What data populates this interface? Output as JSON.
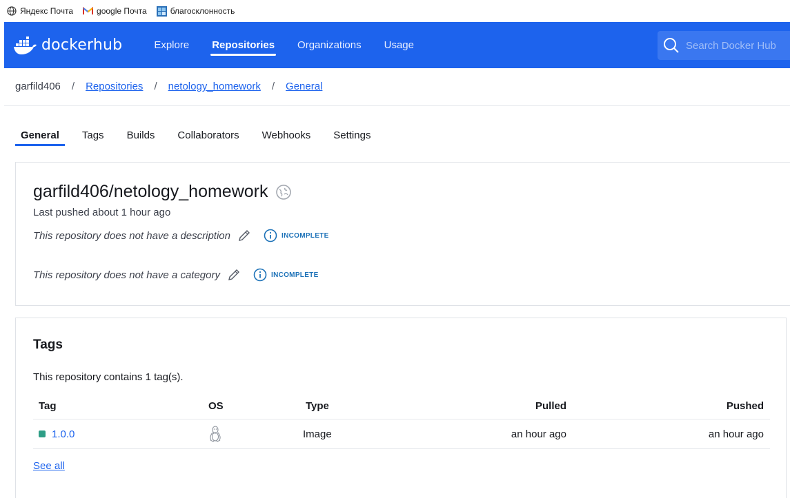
{
  "bookmarks": [
    {
      "label": "Яндекс Почта",
      "icon": "globe-icon"
    },
    {
      "label": "google Почта",
      "icon": "gmail-icon"
    },
    {
      "label": "благосклонность",
      "icon": "grid-icon"
    }
  ],
  "header": {
    "logo_text": "docker",
    "logo_text_2": "hub",
    "nav": [
      {
        "label": "Explore",
        "active": false
      },
      {
        "label": "Repositories",
        "active": true
      },
      {
        "label": "Organizations",
        "active": false
      },
      {
        "label": "Usage",
        "active": false
      }
    ],
    "search_placeholder": "Search Docker Hub",
    "brand_color": "#1d63ed"
  },
  "breadcrumb": {
    "user": "garfild406",
    "separator": "/",
    "links": [
      "Repositories",
      "netology_homework",
      "General"
    ]
  },
  "tabs": [
    {
      "label": "General",
      "active": true
    },
    {
      "label": "Tags",
      "active": false
    },
    {
      "label": "Builds",
      "active": false
    },
    {
      "label": "Collaborators",
      "active": false
    },
    {
      "label": "Webhooks",
      "active": false
    },
    {
      "label": "Settings",
      "active": false
    }
  ],
  "repo": {
    "name": "garfild406/netology_homework",
    "last_pushed": "Last pushed about 1 hour ago",
    "description_note": "This repository does not have a description",
    "category_note": "This repository does not have a category",
    "incomplete_label": "INCOMPLETE"
  },
  "tags_section": {
    "title": "Tags",
    "count_text": "This repository contains 1 tag(s).",
    "columns": [
      "Tag",
      "OS",
      "Type",
      "Pulled",
      "Pushed"
    ],
    "rows": [
      {
        "tag": "1.0.0",
        "os_icon": "linux-icon",
        "type": "Image",
        "pulled": "an hour ago",
        "pushed": "an hour ago"
      }
    ],
    "see_all": "See all"
  }
}
